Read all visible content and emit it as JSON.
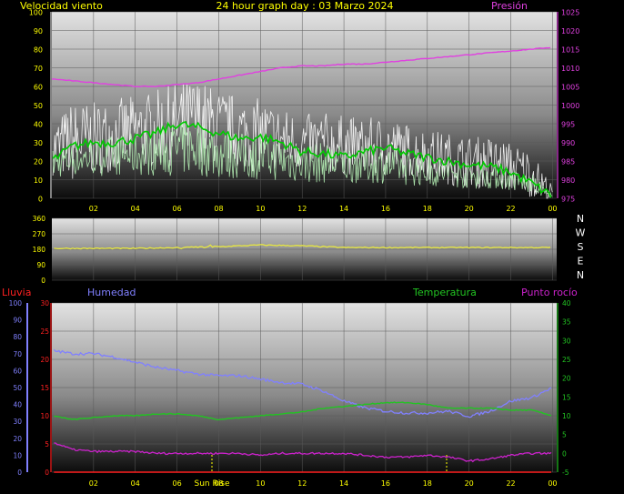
{
  "title": "24 hour graph day : 03 Marzo 2024",
  "x_tick_labels": [
    "02",
    "04",
    "06",
    "08",
    "10",
    "12",
    "14",
    "16",
    "18",
    "20",
    "22",
    "00"
  ],
  "sunrise_label": "Sun Rise",
  "sunset_marker_label": "",
  "colors": {
    "background": "#000000",
    "title": "#ffff00",
    "tick": "#ffff00",
    "wind": "#ffffff",
    "gust": "#b8f5b8",
    "wind_avg": "#00cc00",
    "pressure": "#e040e0",
    "direction": "#e8e840",
    "humidity": "#8080ff",
    "temperature": "#22c422",
    "dewpoint": "#cc22cc",
    "rain": "#ff2020"
  },
  "chart_data": [
    {
      "type": "line",
      "left_axis_label": "Velocidad viento",
      "right_axis_label": "Presión",
      "ylim_left": [
        0,
        100
      ],
      "ylim_right": [
        975,
        1025
      ],
      "yticks_left": [
        "100",
        "90",
        "80",
        "70",
        "60",
        "50",
        "40",
        "30",
        "20",
        "10",
        "0"
      ],
      "yticks_right": [
        "1025",
        "1020",
        "1015",
        "1010",
        "1005",
        "1000",
        "995",
        "990",
        "985",
        "980",
        "975"
      ],
      "grid": true,
      "hours": [
        0,
        1,
        2,
        3,
        4,
        5,
        6,
        7,
        8,
        9,
        10,
        11,
        12,
        13,
        14,
        15,
        16,
        17,
        18,
        19,
        20,
        21,
        22,
        23,
        24
      ],
      "series": [
        {
          "role": "wind_max",
          "values": [
            45,
            60,
            58,
            60,
            62,
            65,
            70,
            72,
            65,
            62,
            60,
            55,
            50,
            52,
            50,
            48,
            50,
            45,
            42,
            40,
            38,
            38,
            35,
            30,
            8
          ]
        },
        {
          "role": "wind_mean",
          "values": [
            25,
            28,
            30,
            32,
            33,
            35,
            38,
            40,
            36,
            33,
            32,
            30,
            28,
            28,
            27,
            26,
            26,
            24,
            22,
            20,
            18,
            18,
            15,
            12,
            2
          ]
        },
        {
          "role": "wind_avg",
          "values": [
            20,
            28,
            30,
            30,
            32,
            35,
            40,
            38,
            35,
            32,
            33,
            30,
            25,
            24,
            22,
            25,
            27,
            24,
            22,
            20,
            18,
            17,
            14,
            8,
            1
          ]
        },
        {
          "role": "gust_low",
          "values": [
            10,
            12,
            12,
            12,
            12,
            12,
            12,
            12,
            10,
            10,
            10,
            9,
            8,
            8,
            8,
            8,
            8,
            7,
            6,
            6,
            5,
            5,
            4,
            2,
            0
          ]
        },
        {
          "role": "pressure",
          "values": [
            1007,
            1006.5,
            1006,
            1005.5,
            1005,
            1005,
            1005.5,
            1006,
            1007,
            1008,
            1009,
            1010,
            1010.5,
            1010.5,
            1011,
            1011,
            1011.5,
            1012,
            1012.5,
            1013,
            1013.5,
            1014,
            1014.5,
            1015,
            1015.5
          ]
        }
      ]
    },
    {
      "type": "line",
      "ylim": [
        0,
        360
      ],
      "yticks": [
        "360",
        "270",
        "180",
        "90",
        "0"
      ],
      "compass_labels": [
        "N",
        "W",
        "S",
        "E",
        "N"
      ],
      "grid": true,
      "hours": [
        0,
        2,
        4,
        6,
        8,
        10,
        12,
        14,
        16,
        18,
        20,
        22,
        24
      ],
      "series": [
        {
          "role": "wind_direction",
          "values": [
            185,
            185,
            185,
            190,
            195,
            205,
            200,
            190,
            190,
            190,
            190,
            190,
            190
          ]
        }
      ]
    },
    {
      "type": "line",
      "left_axis_labels": [
        "Lluvia",
        "Humedad"
      ],
      "right_axis_labels": [
        "Temperatura",
        "Punto rocío"
      ],
      "ylim_humidity": [
        0,
        100
      ],
      "ylim_rain": [
        0,
        30
      ],
      "ylim_temperature": [
        -5,
        40
      ],
      "yticks_humidity": [
        "100",
        "90",
        "80",
        "70",
        "60",
        "50",
        "40",
        "30",
        "20",
        "10",
        "0"
      ],
      "yticks_rain": [
        "30",
        "25",
        "20",
        "15",
        "10",
        "5",
        "0"
      ],
      "yticks_temperature": [
        "40",
        "35",
        "30",
        "25",
        "20",
        "15",
        "10",
        "5",
        "0",
        "-5"
      ],
      "grid": true,
      "hours": [
        0,
        1,
        2,
        3,
        4,
        5,
        6,
        7,
        8,
        9,
        10,
        11,
        12,
        13,
        14,
        15,
        16,
        17,
        18,
        19,
        20,
        21,
        22,
        23,
        24
      ],
      "series": [
        {
          "role": "humidity",
          "values": [
            72,
            70,
            70,
            68,
            65,
            62,
            60,
            58,
            57,
            57,
            55,
            53,
            52,
            48,
            42,
            38,
            36,
            35,
            35,
            36,
            33,
            36,
            42,
            44,
            50
          ]
        },
        {
          "role": "temperature",
          "values": [
            10,
            9,
            9.5,
            10,
            10,
            10.5,
            10.5,
            10,
            9,
            9.5,
            10,
            10.5,
            11,
            12,
            12.5,
            13,
            13.5,
            13.5,
            13,
            12,
            12,
            12,
            11.5,
            11.5,
            10
          ]
        },
        {
          "role": "dewpoint",
          "values": [
            3,
            1,
            0.5,
            0.5,
            0.5,
            0,
            0,
            0,
            0,
            0,
            -0.5,
            0,
            0,
            0,
            0,
            -0.5,
            -1,
            -1,
            -0.5,
            -1,
            -2,
            -1.5,
            -0.5,
            0,
            0
          ]
        },
        {
          "role": "rain",
          "values": [
            0,
            0,
            0,
            0,
            0,
            0,
            0,
            0,
            0,
            0,
            0,
            0,
            0,
            0,
            0,
            0,
            0,
            0,
            0,
            0,
            0,
            0,
            0,
            0,
            0
          ]
        }
      ]
    }
  ]
}
